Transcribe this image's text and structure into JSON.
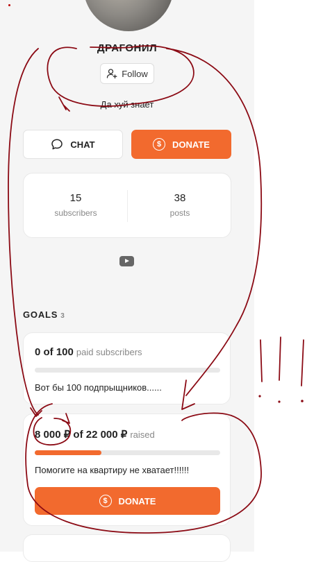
{
  "profile": {
    "name": "ДРАГОНИЛ",
    "follow_label": "Follow",
    "bio": "Да хуй знает"
  },
  "actions": {
    "chat_label": "CHAT",
    "donate_label": "DONATE"
  },
  "stats": {
    "subscribers": {
      "value": "15",
      "label": "subscribers"
    },
    "posts": {
      "value": "38",
      "label": "posts"
    }
  },
  "social": {
    "icon": "youtube-icon"
  },
  "goals": {
    "title": "GOALS",
    "count": "3",
    "items": [
      {
        "amount": "0 of 100",
        "suffix": "paid subscribers",
        "progress": 0,
        "description": "Вот бы 100 подпрыщников......"
      },
      {
        "amount": "8 000 ₽ of 22 000 ₽",
        "suffix": "raised",
        "progress": 0.36,
        "description": "Помогите на квартиру не хватает!!!!!!",
        "donate_label": "DONATE"
      }
    ]
  },
  "colors": {
    "accent": "#f26a2e",
    "panel_background": "#f5f5f5",
    "annotation_ink": "#8b0a14"
  }
}
